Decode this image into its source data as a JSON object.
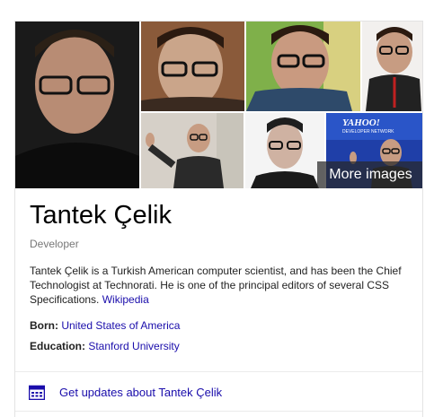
{
  "knowledge_panel": {
    "images": [
      {
        "alt": "Tantek Çelik portrait",
        "sign": ""
      },
      {
        "alt": "Tantek Çelik with glasses",
        "sign": ""
      },
      {
        "alt": "Tantek Çelik at office",
        "sign": ""
      },
      {
        "alt": "Tantek Çelik with badge",
        "sign": ""
      },
      {
        "alt": "Tantek Çelik speaking on stage",
        "sign": ""
      },
      {
        "alt": "Tantek Çelik headshot",
        "sign": ""
      },
      {
        "alt": "Tantek Çelik Yahoo event",
        "sign_top": "YAHOO!",
        "sign_bottom": "DEVELOPER NETWORK"
      }
    ],
    "more_images_label": "More images",
    "name": "Tantek Çelik",
    "subtitle": "Developer",
    "description": "Tantek Çelik is a Turkish American computer scientist, and has been the Chief Technologist at Technorati. He is one of the principal editors of several CSS Specifications.",
    "description_link": "Wikipedia",
    "facts": [
      {
        "label": "Born:",
        "value": "United States of America"
      },
      {
        "label": "Education:",
        "value": "Stanford University"
      }
    ],
    "updates_label": "Get updates about Tantek Çelik",
    "colors": {
      "link": "#1a0dab",
      "subtitle": "#777777",
      "overlay": "#282828"
    }
  }
}
